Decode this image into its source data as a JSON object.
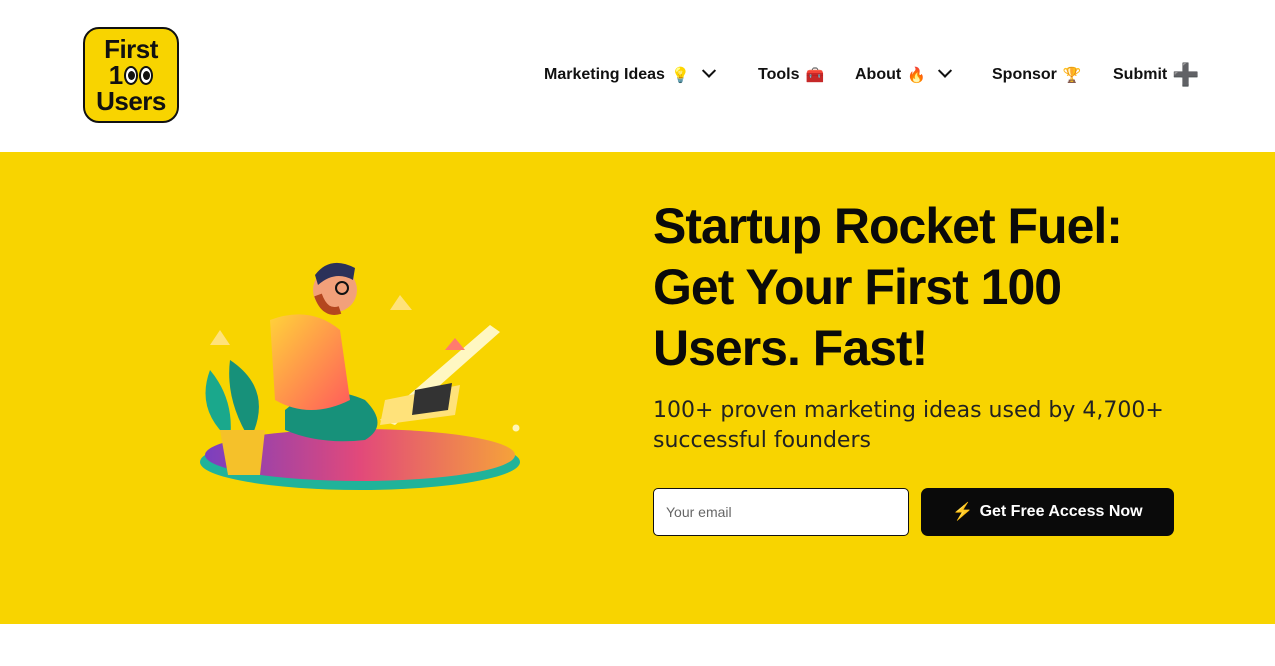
{
  "logo": {
    "line1": "First",
    "line2_digit": "1",
    "line3": "Users"
  },
  "nav": {
    "items": [
      {
        "label": "Marketing Ideas",
        "emoji": "💡",
        "has_dropdown": true
      },
      {
        "label": "Tools",
        "emoji": "🧰",
        "has_dropdown": false
      },
      {
        "label": "About",
        "emoji": "🔥",
        "has_dropdown": true
      },
      {
        "label": "Sponsor",
        "emoji": "🏆",
        "has_dropdown": false
      },
      {
        "label": "Submit",
        "emoji": "➕",
        "has_dropdown": false
      }
    ]
  },
  "hero": {
    "title_line1": "Startup Rocket Fuel:",
    "title_line2": "Get Your First 100",
    "title_line3": "Users. Fast!",
    "subtitle": "100+ proven marketing ideas used by 4,700+ successful founders",
    "email_placeholder": "Your email",
    "cta_icon": "⚡",
    "cta_label": "Get Free Access Now"
  },
  "colors": {
    "accent": "#f8d400",
    "dark": "#0a0a0a",
    "background": "#ffffff"
  }
}
